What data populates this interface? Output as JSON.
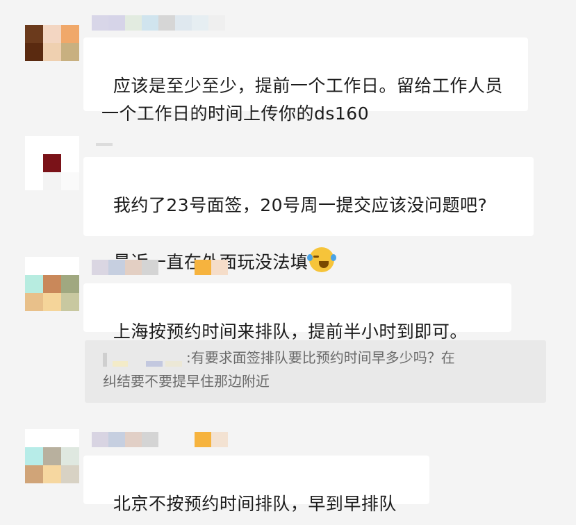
{
  "comments": [
    {
      "author": "",
      "text": "应该是至少至少，提前一个工作日。留给工作人员一个工作日的时间上传你的ds160"
    },
    {
      "author": "",
      "text_line1": "我约了23号面签，20号周一提交应该没问题吧?",
      "text_line2": "最近一直在外面玩没法填",
      "emoji": "crying-laughing-emoji"
    },
    {
      "author": "",
      "text": "上海按预约时间来排队，提前半小时到即可。",
      "quote_line1": ":有要求面签排队要比预约时间早多少吗？在",
      "quote_line2": "纠结要不要提早住那边附近"
    },
    {
      "author": "",
      "text": "北京不按预约时间排队，早到早排队"
    }
  ]
}
